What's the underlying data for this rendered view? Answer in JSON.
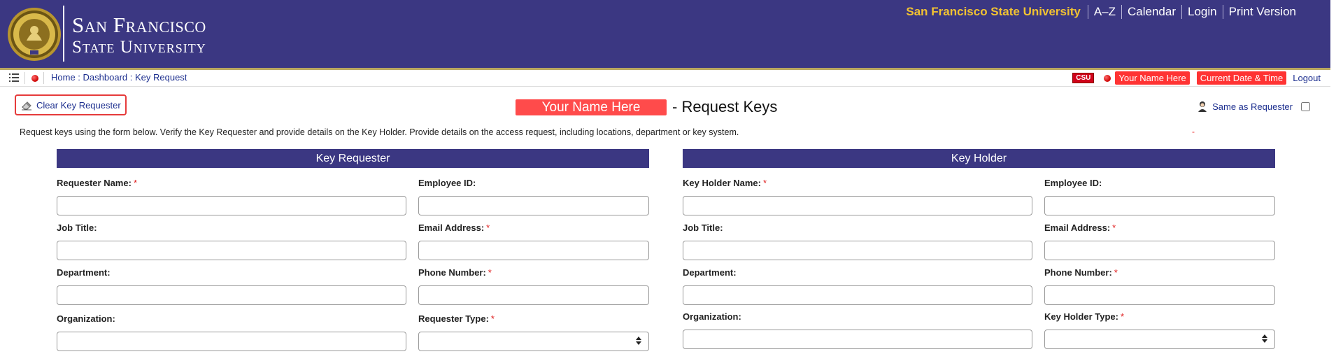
{
  "header": {
    "logo_line1": "San Francisco",
    "logo_line2": "State University",
    "nav": [
      {
        "label": "San Francisco State University"
      },
      {
        "label": "A–Z"
      },
      {
        "label": "Calendar"
      },
      {
        "label": "Login"
      },
      {
        "label": "Print Version"
      }
    ]
  },
  "breadcrumb_bar": {
    "items": [
      "Home",
      "Dashboard",
      "Key Request"
    ],
    "separator": " : ",
    "csu_badge": "CSU",
    "user_name": "Your Name Here",
    "date_time": "Current Date & Time",
    "logout": "Logout"
  },
  "request": {
    "clear_button": "Clear Key Requester",
    "name_placeholder": "Your Name Here",
    "title_suffix": "- Request Keys",
    "same_as_label": "Same as Requester",
    "intro": "Request keys using the form below. Verify the Key Requester and provide details on the Key Holder. Provide details on the access request, including locations, department or key system.",
    "red_mark": "-"
  },
  "key_requester": {
    "heading": "Key Requester",
    "fields": {
      "name": "Requester Name:",
      "employee_id": "Employee ID:",
      "job_title": "Job Title:",
      "email": "Email Address:",
      "department": "Department:",
      "phone": "Phone Number:",
      "organization": "Organization:",
      "type": "Requester Type:"
    }
  },
  "key_holder": {
    "heading": "Key Holder",
    "fields": {
      "name": "Key Holder Name:",
      "employee_id": "Employee ID:",
      "job_title": "Job Title:",
      "email": "Email Address:",
      "department": "Department:",
      "phone": "Phone Number:",
      "organization": "Organization:",
      "type": "Key Holder Type:"
    }
  },
  "required_mark": "*",
  "colors": {
    "banner": "#3b3782",
    "gold": "#f1c232",
    "accent_red": "#ff4b4b",
    "link_blue": "#1d2f8f"
  },
  "icons": [
    "university-seal-icon",
    "list-icon",
    "red-dot-icon",
    "eraser-icon",
    "person-icon",
    "select-arrows-icon"
  ]
}
